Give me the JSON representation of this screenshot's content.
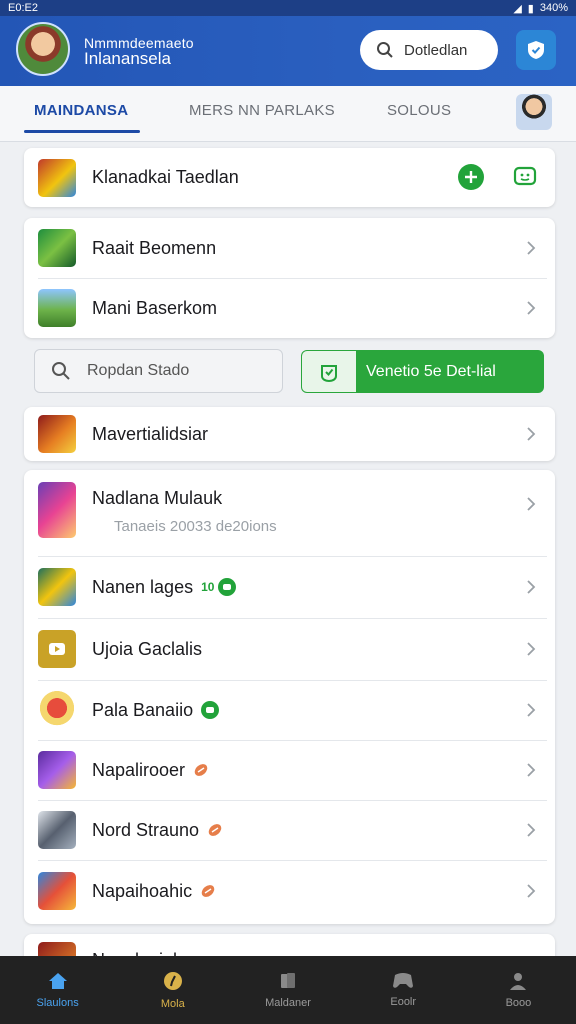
{
  "status_bar": {
    "time": "E0:E2",
    "battery": "340%"
  },
  "header": {
    "brand_line1": "Nmmmdeemaeto",
    "brand_line2": "Inlanansela",
    "search_label": "Dotledlan"
  },
  "tabs": [
    {
      "label": "MAINDANSA",
      "active": true
    },
    {
      "label": "MERS NN PARLAKS",
      "active": false
    },
    {
      "label": "SOLOUS",
      "active": false
    }
  ],
  "card1": {
    "label": "Klanadkai Taedlan"
  },
  "card2": {
    "items": [
      {
        "label": "Raait Beomenn"
      },
      {
        "label": "Mani Baserkom"
      }
    ]
  },
  "search": {
    "placeholder": "Ropdan Stado"
  },
  "action_button": {
    "label": "Venetio 5e Det-lial"
  },
  "card3": {
    "label": "Mavertialidsiar"
  },
  "list": {
    "items": [
      {
        "label": "Nadlana Mulauk",
        "subtitle": "Tanaeis 20033 de20ions"
      },
      {
        "label": "Nanen lages",
        "badge_text": "10"
      },
      {
        "label": "Ujoia Gaclalis"
      },
      {
        "label": "Pala Banaiio"
      },
      {
        "label": "Napalirooer"
      },
      {
        "label": "Nord Strauno"
      },
      {
        "label": "Napaihoahic"
      },
      {
        "label": "Nanalnaiola"
      }
    ]
  },
  "bottom_nav": [
    {
      "label": "Slaulons",
      "icon": "home-icon",
      "active": true
    },
    {
      "label": "Mola",
      "icon": "compass-icon",
      "active": false
    },
    {
      "label": "Maldaner",
      "icon": "document-icon",
      "active": false
    },
    {
      "label": "Eoolr",
      "icon": "controller-icon",
      "active": false
    },
    {
      "label": "Booo",
      "icon": "profile-icon",
      "active": false
    }
  ],
  "colors": {
    "primary": "#2356b6",
    "accent_green": "#2aa63c",
    "nav_bg": "#222222",
    "nav_active": "#4aa3f0"
  }
}
